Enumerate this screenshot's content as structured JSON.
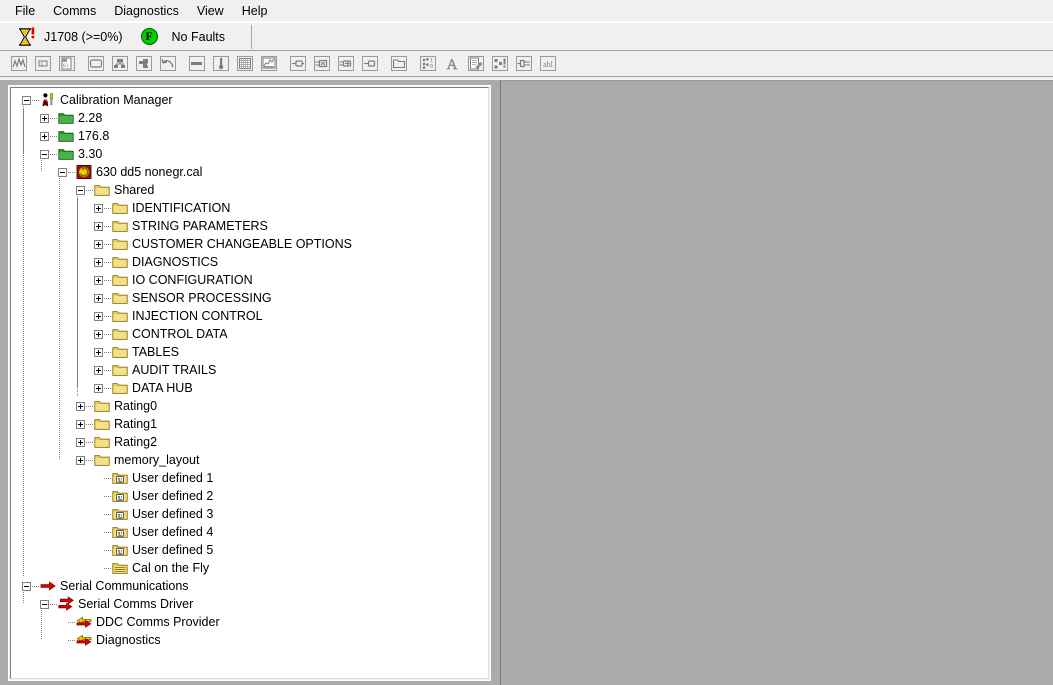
{
  "app": {
    "title": "Calibration Manager"
  },
  "menubar": {
    "items": [
      {
        "label": "File",
        "name": "menu-file"
      },
      {
        "label": "Comms",
        "name": "menu-comms"
      },
      {
        "label": "Diagnostics",
        "name": "menu-diagnostics"
      },
      {
        "label": "View",
        "name": "menu-view"
      },
      {
        "label": "Help",
        "name": "menu-help"
      }
    ]
  },
  "statusbar": {
    "hourglass_icon": "hourglass-alert-icon",
    "protocol": "J1708 (>=0%)",
    "fault_badge": "F",
    "fault_badge_color": "#00d000",
    "fault_text": "No Faults"
  },
  "toolbar": {
    "buttons": [
      {
        "name": "waveform-graph-icon",
        "glyph": "waveform",
        "enabled": false
      },
      {
        "name": "constant-box-icon",
        "glyph": "cbox",
        "enabled": false
      },
      {
        "name": "calibration-file-icon",
        "glyph": "calfile",
        "enabled": false
      },
      {
        "name": "rounded-window-icon",
        "glyph": "window",
        "enabled": false
      },
      {
        "name": "network-nodes-icon",
        "glyph": "nodes",
        "enabled": false
      },
      {
        "name": "puzzle-piece-icon",
        "glyph": "puzzle",
        "enabled": false
      },
      {
        "name": "undo-arrow-icon",
        "glyph": "undo",
        "enabled": false
      },
      {
        "name": "slider-bar-icon",
        "glyph": "sliderbar",
        "enabled": false
      },
      {
        "name": "thermometer-icon",
        "glyph": "thermo",
        "enabled": false
      },
      {
        "name": "grid-table-icon",
        "glyph": "grid",
        "enabled": false
      },
      {
        "name": "chart-data-icon",
        "glyph": "chart",
        "enabled": false
      },
      {
        "name": "connector-plug-icon",
        "glyph": "plug1",
        "enabled": false
      },
      {
        "name": "connector-box-icon",
        "glyph": "plug2",
        "enabled": false
      },
      {
        "name": "connector-arrow-icon",
        "glyph": "plug3",
        "enabled": false
      },
      {
        "name": "connector-small-icon",
        "glyph": "plug4",
        "enabled": false
      },
      {
        "name": "folder-outline-icon",
        "glyph": "folder",
        "enabled": false
      },
      {
        "name": "bits-binary-icon",
        "glyph": "bits",
        "enabled": false
      },
      {
        "name": "text-letter-icon",
        "glyph": "letterA",
        "enabled": false
      },
      {
        "name": "document-edit-icon",
        "glyph": "docedit",
        "enabled": false
      },
      {
        "name": "dots-alert-icon",
        "glyph": "dotsalert",
        "enabled": false
      },
      {
        "name": "pin-connector-icon",
        "glyph": "pin",
        "enabled": false
      },
      {
        "name": "label-abl-icon",
        "glyph": "abl",
        "enabled": false
      }
    ]
  },
  "tree": {
    "nodes": [
      {
        "id": "n0",
        "depth": 0,
        "label": "Calibration Manager",
        "icon": "manager-tool-icon",
        "expander": "minus"
      },
      {
        "id": "n1",
        "depth": 1,
        "label": "2.28",
        "icon": "folder-green-icon",
        "expander": "plus"
      },
      {
        "id": "n2",
        "depth": 1,
        "label": "176.8",
        "icon": "folder-green-icon",
        "expander": "plus"
      },
      {
        "id": "n3",
        "depth": 1,
        "label": "3.30",
        "icon": "folder-green-icon",
        "expander": "minus"
      },
      {
        "id": "n4",
        "depth": 2,
        "label": "630 dd5 nonegr.cal",
        "icon": "cal-file-icon",
        "expander": "minus"
      },
      {
        "id": "n5",
        "depth": 3,
        "label": "Shared",
        "icon": "folder-yellow-icon",
        "expander": "minus"
      },
      {
        "id": "n6",
        "depth": 4,
        "label": "IDENTIFICATION",
        "icon": "folder-yellow-icon",
        "expander": "plus"
      },
      {
        "id": "n7",
        "depth": 4,
        "label": "STRING PARAMETERS",
        "icon": "folder-yellow-icon",
        "expander": "plus"
      },
      {
        "id": "n8",
        "depth": 4,
        "label": "CUSTOMER CHANGEABLE OPTIONS",
        "icon": "folder-yellow-icon",
        "expander": "plus"
      },
      {
        "id": "n9",
        "depth": 4,
        "label": "DIAGNOSTICS",
        "icon": "folder-yellow-icon",
        "expander": "plus"
      },
      {
        "id": "n10",
        "depth": 4,
        "label": "IO CONFIGURATION",
        "icon": "folder-yellow-icon",
        "expander": "plus"
      },
      {
        "id": "n11",
        "depth": 4,
        "label": "SENSOR PROCESSING",
        "icon": "folder-yellow-icon",
        "expander": "plus"
      },
      {
        "id": "n12",
        "depth": 4,
        "label": "INJECTION CONTROL",
        "icon": "folder-yellow-icon",
        "expander": "plus"
      },
      {
        "id": "n13",
        "depth": 4,
        "label": "CONTROL DATA",
        "icon": "folder-yellow-icon",
        "expander": "plus"
      },
      {
        "id": "n14",
        "depth": 4,
        "label": "TABLES",
        "icon": "folder-yellow-icon",
        "expander": "plus"
      },
      {
        "id": "n15",
        "depth": 4,
        "label": "AUDIT TRAILS",
        "icon": "folder-yellow-icon",
        "expander": "plus"
      },
      {
        "id": "n16",
        "depth": 4,
        "label": "DATA HUB",
        "icon": "folder-yellow-icon",
        "expander": "plus"
      },
      {
        "id": "n17",
        "depth": 3,
        "label": "Rating0",
        "icon": "folder-yellow-icon",
        "expander": "plus"
      },
      {
        "id": "n18",
        "depth": 3,
        "label": "Rating1",
        "icon": "folder-yellow-icon",
        "expander": "plus"
      },
      {
        "id": "n19",
        "depth": 3,
        "label": "Rating2",
        "icon": "folder-yellow-icon",
        "expander": "plus"
      },
      {
        "id": "n20",
        "depth": 3,
        "label": "memory_layout",
        "icon": "folder-yellow-icon",
        "expander": "plus"
      },
      {
        "id": "n21",
        "depth": 4,
        "label": "User defined 1",
        "icon": "folder-user-icon",
        "expander": "none"
      },
      {
        "id": "n22",
        "depth": 4,
        "label": "User defined 2",
        "icon": "folder-user-icon",
        "expander": "none"
      },
      {
        "id": "n23",
        "depth": 4,
        "label": "User defined 3",
        "icon": "folder-user-icon",
        "expander": "none"
      },
      {
        "id": "n24",
        "depth": 4,
        "label": "User defined 4",
        "icon": "folder-user-icon",
        "expander": "none"
      },
      {
        "id": "n25",
        "depth": 4,
        "label": "User defined 5",
        "icon": "folder-user-icon",
        "expander": "none"
      },
      {
        "id": "n26",
        "depth": 4,
        "label": "Cal on the Fly",
        "icon": "folder-striped-icon",
        "expander": "none"
      },
      {
        "id": "n27",
        "depth": 0,
        "label": "Serial Communications",
        "icon": "red-arrow-icon",
        "expander": "minus"
      },
      {
        "id": "n28",
        "depth": 1,
        "label": "Serial Comms Driver",
        "icon": "red-double-arrow-icon",
        "expander": "minus"
      },
      {
        "id": "n29",
        "depth": 2,
        "label": "DDC Comms Provider",
        "icon": "exchange-arrows-icon",
        "expander": "none"
      },
      {
        "id": "n30",
        "depth": 2,
        "label": "Diagnostics",
        "icon": "exchange-arrows-icon",
        "expander": "none"
      }
    ]
  },
  "mdi": {
    "background_color": "#ababab"
  }
}
